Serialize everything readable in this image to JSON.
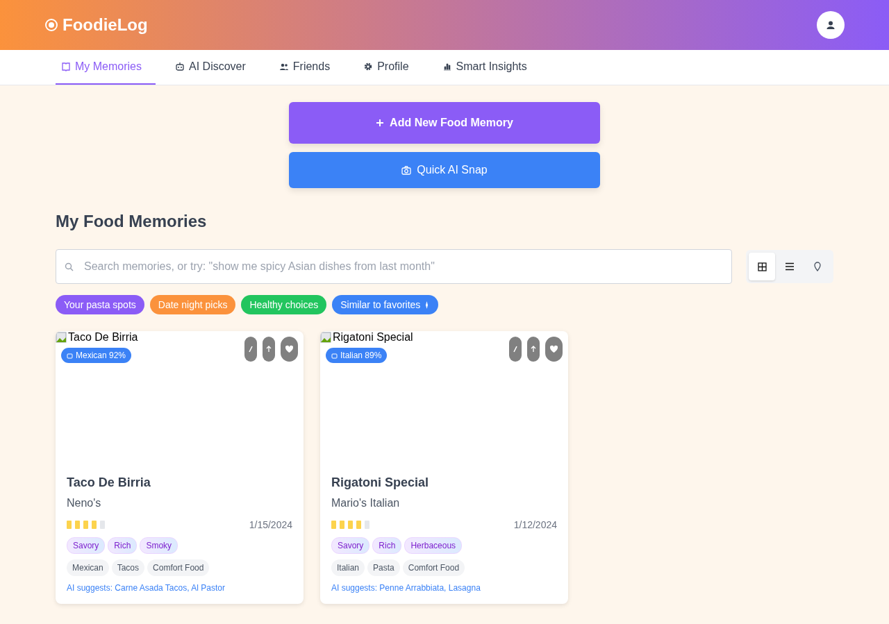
{
  "header": {
    "brand": "FoodieLog"
  },
  "tabs": [
    {
      "label": "My Memories",
      "kind": "memories",
      "selected": true
    },
    {
      "label": "AI Discover",
      "kind": "discover",
      "selected": false
    },
    {
      "label": "Friends",
      "kind": "friends",
      "selected": false
    },
    {
      "label": "Profile",
      "kind": "profile",
      "selected": false
    },
    {
      "label": "Smart Insights",
      "kind": "insights",
      "selected": false
    }
  ],
  "actions": [
    {
      "label": "Add New Food Memory",
      "kind": "primary"
    },
    {
      "label": "Quick AI Snap",
      "kind": "secondary"
    }
  ],
  "section_title": "My Food Memories",
  "search": {
    "placeholder": "Search memories, or try: \"show me spicy Asian dishes from last month\""
  },
  "view_modes": [
    {
      "kind": "grid",
      "selected": true
    },
    {
      "kind": "list",
      "selected": false
    },
    {
      "kind": "map",
      "selected": false
    }
  ],
  "chips": [
    {
      "label": "Your pasta spots",
      "color": "#8b5cf6",
      "trailing_icon": false
    },
    {
      "label": "Date night picks",
      "color": "#fb923c",
      "trailing_icon": false
    },
    {
      "label": "Healthy choices",
      "color": "#22c55e",
      "trailing_icon": false
    },
    {
      "label": "Similar to favorites",
      "color": "#3b82f6",
      "trailing_icon": true
    }
  ],
  "memories": [
    {
      "image_alt": "Taco De Birria",
      "badge": "Mexican 92%",
      "title": "Taco De Birria",
      "place": "Neno's",
      "stars": 4,
      "date": "1/15/2024",
      "flavors": [
        "Savory",
        "Rich",
        "Smoky"
      ],
      "tags": [
        "Mexican",
        "Tacos",
        "Comfort Food"
      ],
      "suggestion": "AI suggests: Carne Asada Tacos, Al Pastor"
    },
    {
      "image_alt": "Rigatoni Special",
      "badge": "Italian 89%",
      "title": "Rigatoni Special",
      "place": "Mario's Italian",
      "stars": 4,
      "date": "1/12/2024",
      "flavors": [
        "Savory",
        "Rich",
        "Herbaceous"
      ],
      "tags": [
        "Italian",
        "Pasta",
        "Comfort Food"
      ],
      "suggestion": "AI suggests: Penne Arrabbiata, Lasagna"
    }
  ]
}
